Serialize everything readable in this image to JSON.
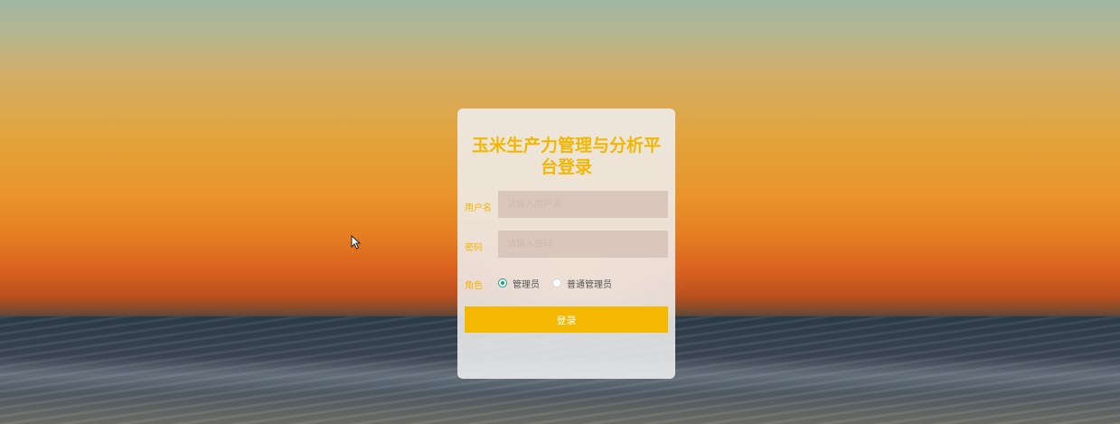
{
  "login": {
    "title_line1": "玉米生产力管理与分析平",
    "title_line2": "台登录",
    "username_label": "用户名",
    "username_placeholder": "请输入用户名",
    "password_label": "密码",
    "password_placeholder": "请输入密码",
    "role_label": "角色",
    "roles": [
      {
        "label": "管理员",
        "selected": true
      },
      {
        "label": "普通管理员",
        "selected": false
      }
    ],
    "submit_label": "登录"
  },
  "colors": {
    "accent": "#f5b800",
    "title": "#f2b705",
    "radio_checked": "#14a37f",
    "input_bg": "#d9c7be"
  }
}
